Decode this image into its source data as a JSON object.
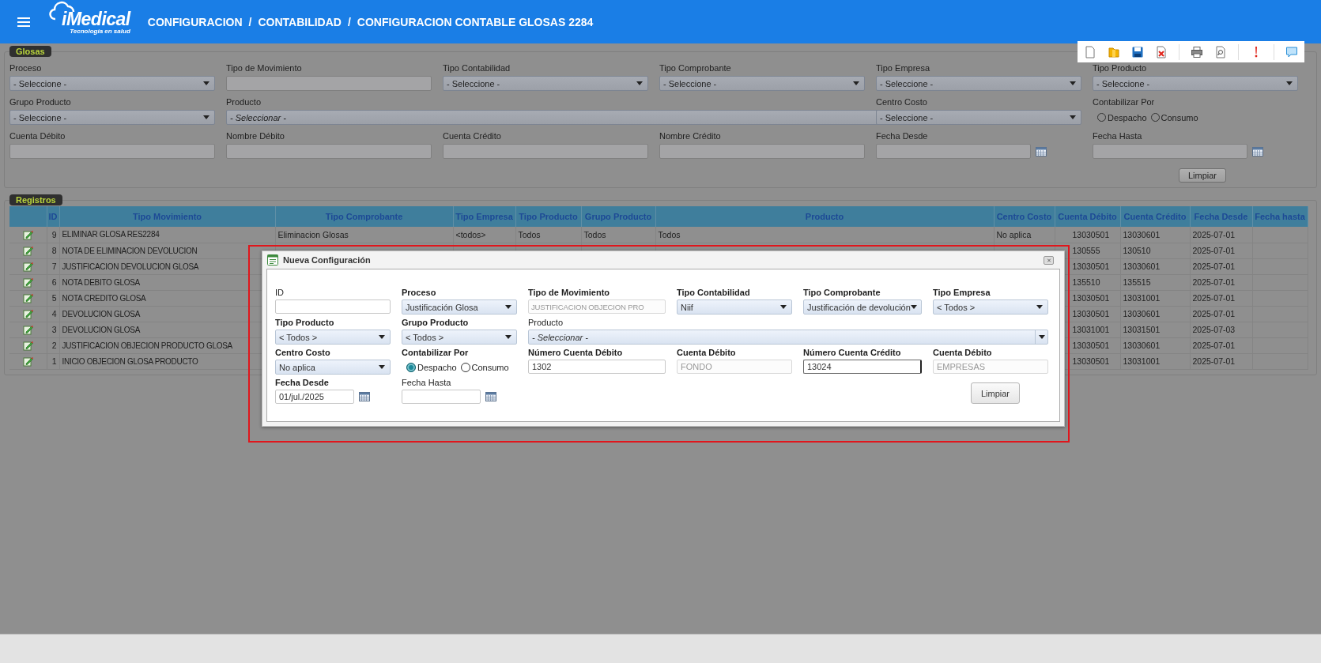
{
  "header": {
    "brand": "iMedical",
    "tagline": "Tecnología en salud",
    "breadcrumb": [
      "CONFIGURACION",
      "CONTABILIDAD",
      "CONFIGURACION CONTABLE GLOSAS 2284"
    ],
    "separator": "/"
  },
  "toolbar": [
    {
      "kind": "new"
    },
    {
      "kind": "open"
    },
    {
      "kind": "save"
    },
    {
      "kind": "delete"
    },
    {
      "kind": "print"
    },
    {
      "kind": "preview"
    },
    {
      "kind": "alert"
    },
    {
      "kind": "chat"
    }
  ],
  "filters": {
    "legend": "Glosas",
    "fields": [
      {
        "label": "Proceso",
        "kind": "select",
        "value": "- Seleccione -"
      },
      {
        "label": "Tipo de Movimiento",
        "kind": "text"
      },
      {
        "label": "Tipo Contabilidad",
        "kind": "select",
        "value": "- Seleccione -"
      },
      {
        "label": "Tipo Comprobante",
        "kind": "select",
        "value": "- Seleccione -"
      },
      {
        "label": "Tipo Empresa",
        "kind": "select",
        "value": "- Seleccione -"
      },
      {
        "label": "Tipo Producto",
        "kind": "select",
        "value": "- Seleccione -"
      },
      {
        "label": "Grupo Producto",
        "kind": "select",
        "value": "- Seleccione -"
      },
      {
        "label": "Producto",
        "kind": "combo",
        "placeholder": "- Seleccionar -"
      },
      {
        "label": "Centro Costo",
        "kind": "select",
        "value": "- Seleccione -"
      },
      {
        "label": "Contabilizar Por",
        "kind": "radio",
        "options": [
          {
            "label": "Despacho",
            "selected": false
          },
          {
            "label": "Consumo",
            "selected": false
          }
        ]
      },
      {
        "label": "Cuenta Débito",
        "kind": "text"
      },
      {
        "label": "Nombre Débito",
        "kind": "text"
      },
      {
        "label": "Cuenta Crédito",
        "kind": "text"
      },
      {
        "label": "Nombre Crédito",
        "kind": "text"
      },
      {
        "label": "Fecha Desde",
        "kind": "date"
      },
      {
        "label": "Fecha Hasta",
        "kind": "date"
      }
    ],
    "buttons": [
      "Limpiar"
    ]
  },
  "records": {
    "legend": "Registros",
    "columns": [
      "ID",
      "Tipo Movimiento",
      "Tipo Comprobante",
      "Tipo Empresa",
      "Tipo Producto",
      "Grupo Producto",
      "Producto",
      "Centro Costo",
      "Cuenta Débito",
      "Cuenta Crédito",
      "Fecha Desde",
      "Fecha hasta"
    ],
    "rows": [
      {
        "cells": [
          "9",
          "ELIMINAR GLOSA RES2284",
          "Eliminacion Glosas",
          "<todos>",
          "Todos",
          "Todos",
          "Todos",
          "No aplica",
          "13030501",
          "13030601",
          "2025-07-01",
          null
        ]
      },
      {
        "cells": [
          "8",
          "NOTA DE ELIMINACION DEVOLUCION",
          null,
          null,
          null,
          null,
          null,
          null,
          "130555",
          "130510",
          "2025-07-01",
          null
        ]
      },
      {
        "cells": [
          "7",
          "JUSTIFICACION DEVOLUCION GLOSA",
          null,
          null,
          null,
          null,
          null,
          null,
          "13030501",
          "13030601",
          "2025-07-01",
          null
        ]
      },
      {
        "cells": [
          "6",
          "NOTA DEBITO GLOSA",
          null,
          null,
          null,
          null,
          null,
          null,
          "135510",
          "135515",
          "2025-07-01",
          null
        ]
      },
      {
        "cells": [
          "5",
          "NOTA CREDITO GLOSA",
          null,
          null,
          null,
          null,
          null,
          null,
          "13030501",
          "13031001",
          "2025-07-01",
          null
        ]
      },
      {
        "cells": [
          "4",
          "DEVOLUCION GLOSA",
          null,
          null,
          null,
          null,
          null,
          null,
          "13030501",
          "13030601",
          "2025-07-01",
          null
        ]
      },
      {
        "cells": [
          "3",
          "DEVOLUCION GLOSA",
          null,
          null,
          null,
          null,
          null,
          null,
          "13031001",
          "13031501",
          "2025-07-03",
          null
        ]
      },
      {
        "cells": [
          "2",
          "JUSTIFICACION OBJECION PRODUCTO GLOSA",
          null,
          null,
          null,
          null,
          null,
          null,
          "13030501",
          "13030601",
          "2025-07-01",
          null
        ]
      },
      {
        "cells": [
          "1",
          "INICIO OBJECION GLOSA PRODUCTO",
          null,
          null,
          null,
          null,
          null,
          null,
          "13030501",
          "13031001",
          "2025-07-01",
          null
        ]
      }
    ]
  },
  "dialog": {
    "title": "Nueva Configuración",
    "fields": [
      {
        "label": "ID",
        "kind": "text",
        "required": false,
        "disabled": false,
        "focused": false
      },
      {
        "label": "Proceso",
        "kind": "select",
        "value": "Justificación Glosa",
        "required": true,
        "disabled": false,
        "focused": false
      },
      {
        "label": "Tipo de Movimiento",
        "kind": "text",
        "value": "JUSTIFICACION OBJECION PRO",
        "required": true,
        "disabled": true,
        "focused": false
      },
      {
        "label": "Tipo Contabilidad",
        "kind": "select",
        "value": "Niif",
        "required": true,
        "disabled": false,
        "focused": false
      },
      {
        "label": "Tipo Comprobante",
        "kind": "select",
        "value": "Justificación de devolución",
        "required": true,
        "disabled": false,
        "focused": false
      },
      {
        "label": "Tipo Empresa",
        "kind": "select",
        "value": "< Todos >",
        "required": true,
        "disabled": false,
        "focused": false
      },
      {
        "label": "Tipo Producto",
        "kind": "select",
        "value": "< Todos >",
        "required": true,
        "disabled": false,
        "focused": false
      },
      {
        "label": "Grupo Producto",
        "kind": "select",
        "value": "< Todos >",
        "required": true,
        "disabled": false,
        "focused": false
      },
      {
        "label": "Producto",
        "kind": "combo",
        "placeholder": "- Seleccionar -",
        "required": false,
        "disabled": false,
        "focused": false
      },
      {
        "label": "Centro Costo",
        "kind": "select",
        "value": "No aplica",
        "required": true,
        "disabled": false,
        "focused": false
      },
      {
        "label": "Contabilizar Por",
        "kind": "radio",
        "options": [
          {
            "label": "Despacho",
            "selected": true
          },
          {
            "label": "Consumo",
            "selected": false
          }
        ],
        "required": true,
        "disabled": false,
        "focused": false
      },
      {
        "label": "Número Cuenta Débito",
        "kind": "text",
        "value": "1302",
        "required": true,
        "disabled": false,
        "focused": false
      },
      {
        "label": "Cuenta Débito",
        "kind": "text",
        "value": "FONDO",
        "required": true,
        "disabled": true,
        "focused": false
      },
      {
        "label": "Número Cuenta Crédito",
        "kind": "text",
        "value": "13024",
        "required": true,
        "disabled": false,
        "focused": true
      },
      {
        "label": "Cuenta Débito",
        "kind": "text",
        "value": "EMPRESAS",
        "required": true,
        "disabled": true,
        "focused": false
      },
      {
        "label": "Fecha Desde",
        "kind": "date",
        "value": "01/jul./2025",
        "required": true,
        "disabled": false,
        "focused": false
      },
      {
        "label": "Fecha Hasta",
        "kind": "date",
        "required": false,
        "disabled": false,
        "focused": false
      }
    ],
    "buttons": [
      "Limpiar"
    ]
  }
}
